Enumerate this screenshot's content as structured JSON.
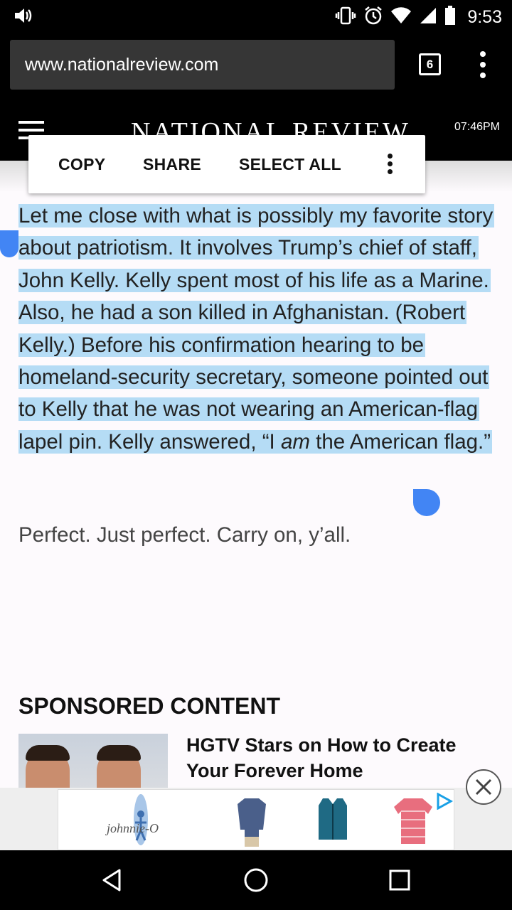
{
  "status_bar": {
    "time": "9:53",
    "icons": [
      "volume-icon",
      "vibrate-icon",
      "alarm-icon",
      "wifi-icon",
      "signal-icon",
      "battery-icon"
    ]
  },
  "browser": {
    "url": "www.nationalreview.com",
    "tab_count": "6",
    "menu_icon": "more-vert-icon"
  },
  "site": {
    "logo": "NATIONAL REVIEW",
    "time": "07:46PM",
    "menu_icon": "hamburger-icon"
  },
  "context_menu": {
    "copy": "COPY",
    "share": "SHARE",
    "select_all": "SELECT ALL",
    "more_icon": "more-vert-icon"
  },
  "article": {
    "selected_part1": "Let me close with what is possibly my favorite story about patriotism. It involves Trump’s chief of staff, John Kelly. Kelly spent most of his life as a Marine. Also, he had a son killed in Afghanistan. (Robert Kelly.) Before his confirmation hearing to be homeland-security secretary, someone pointed out to Kelly that he was not wearing an American-flag lapel pin. Kelly answered, “I ",
    "selected_emphasis": "am",
    "selected_part2": " the American flag.”",
    "paragraph2": "Perfect. Just perfect. Carry on, y’all."
  },
  "sponsored": {
    "heading": "SPONSORED CONTENT",
    "headline": "HGTV Stars on How to Create Your Forever Home"
  },
  "ad": {
    "brand": "johnnie-O",
    "close_icon": "close-icon",
    "adchoices_icon": "adchoices-icon"
  },
  "nav_bar": {
    "icons": [
      "back-icon",
      "home-icon",
      "recents-icon"
    ]
  },
  "colors": {
    "selection": "#b5dcf5",
    "handle": "#4285f4",
    "chrome": "#000000",
    "urlbar": "#363636"
  }
}
